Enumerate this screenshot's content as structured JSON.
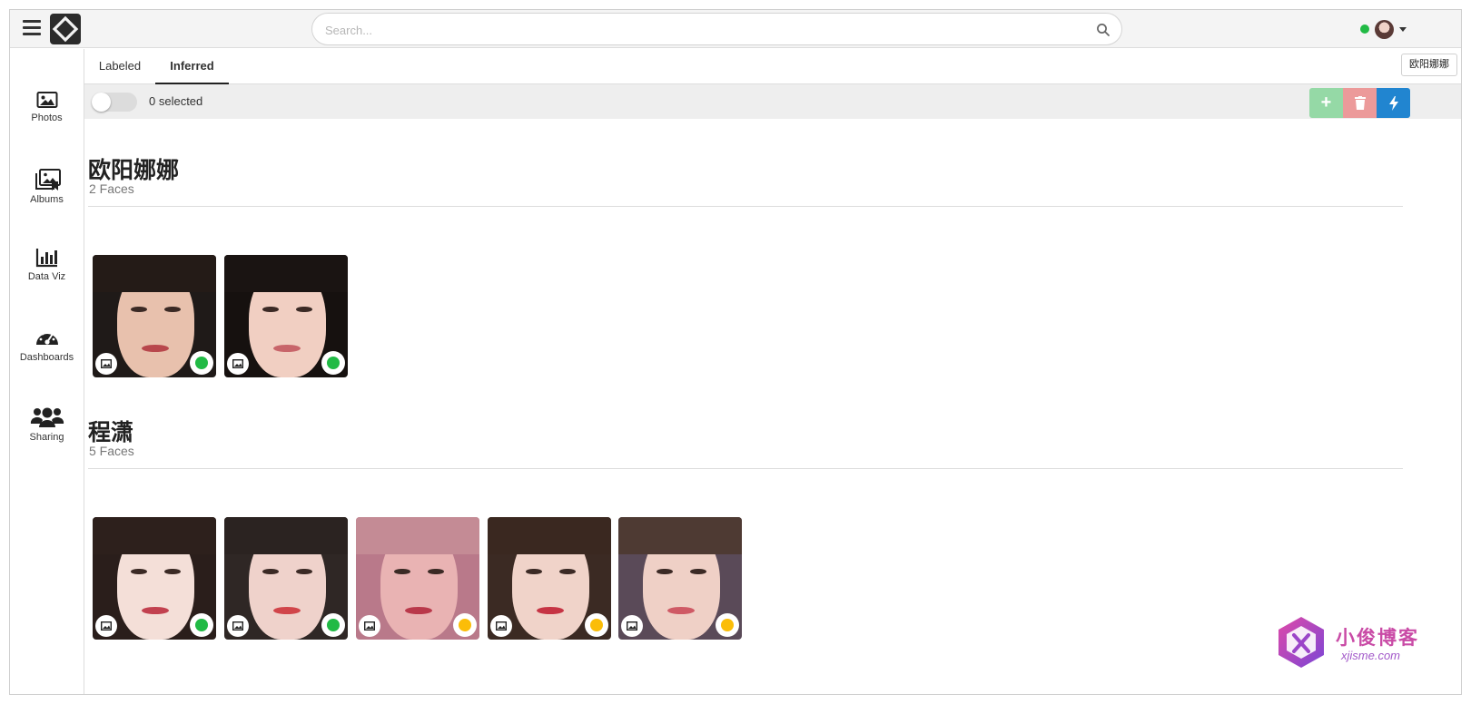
{
  "search": {
    "placeholder": "Search..."
  },
  "sidebar": {
    "items": [
      {
        "label": "Photos",
        "icon": "image-icon"
      },
      {
        "label": "Albums",
        "icon": "albums-icon"
      },
      {
        "label": "Data Viz",
        "icon": "bar-chart-icon"
      },
      {
        "label": "Dashboards",
        "icon": "gauge-icon"
      },
      {
        "label": "Sharing",
        "icon": "users-icon"
      }
    ]
  },
  "tabs": [
    {
      "label": "Labeled",
      "active": false
    },
    {
      "label": "Inferred",
      "active": true
    }
  ],
  "person_filter": {
    "label": "欧阳娜娜"
  },
  "toolbar": {
    "selected_text": "0 selected",
    "add_label": "+",
    "actions": [
      "add",
      "delete",
      "train"
    ]
  },
  "groups": [
    {
      "name": "欧阳娜娜",
      "count_text": "2 Faces",
      "faces": [
        {
          "confidence": "high"
        },
        {
          "confidence": "high"
        }
      ]
    },
    {
      "name": "程潇",
      "count_text": "5 Faces",
      "faces": [
        {
          "confidence": "high"
        },
        {
          "confidence": "high"
        },
        {
          "confidence": "medium"
        },
        {
          "confidence": "medium"
        },
        {
          "confidence": "medium"
        }
      ]
    }
  ],
  "colors": {
    "online": "#21ba45",
    "confidence_high": "#21ba45",
    "confidence_medium": "#fbbd08",
    "add_button": "#95d9a6",
    "delete_button": "#ec9a9a",
    "train_button": "#2185d0"
  },
  "watermark": {
    "title": "小俊博客",
    "url": "xjisme.com"
  }
}
